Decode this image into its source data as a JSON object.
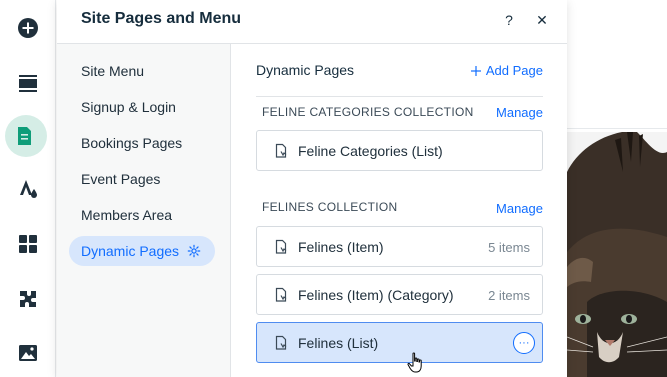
{
  "panel": {
    "title": "Site Pages and Menu",
    "help_label": "?",
    "close_label": "✕"
  },
  "nav": {
    "items": [
      {
        "label": "Site Menu",
        "active": false
      },
      {
        "label": "Signup & Login",
        "active": false
      },
      {
        "label": "Bookings Pages",
        "active": false
      },
      {
        "label": "Event Pages",
        "active": false
      },
      {
        "label": "Members Area",
        "active": false
      },
      {
        "label": "Dynamic Pages",
        "active": true
      }
    ]
  },
  "content": {
    "section_title": "Dynamic Pages",
    "add_page_label": "Add Page",
    "collections": [
      {
        "title": "FELINE CATEGORIES COLLECTION",
        "manage_label": "Manage",
        "pages": [
          {
            "label": "Feline Categories (List)",
            "count": ""
          }
        ]
      },
      {
        "title": "FELINES COLLECTION",
        "manage_label": "Manage",
        "pages": [
          {
            "label": "Felines (Item)",
            "count": "5 items"
          },
          {
            "label": "Felines (Item) (Category)",
            "count": "2 items"
          },
          {
            "label": "Felines (List)",
            "count": "",
            "selected": true
          }
        ]
      }
    ],
    "more_actions_label": "···"
  },
  "toolbar": {
    "icons": [
      "add-icon",
      "menus-icon",
      "pages-icon",
      "design-icon",
      "apps-icon",
      "business-icon",
      "media-icon"
    ],
    "active": "pages-icon"
  },
  "colors": {
    "accent": "#116dff",
    "selected_bg": "#d7e6fc",
    "active_tool_bg": "#d5ede6",
    "active_tool_fg": "#0f9d79"
  }
}
